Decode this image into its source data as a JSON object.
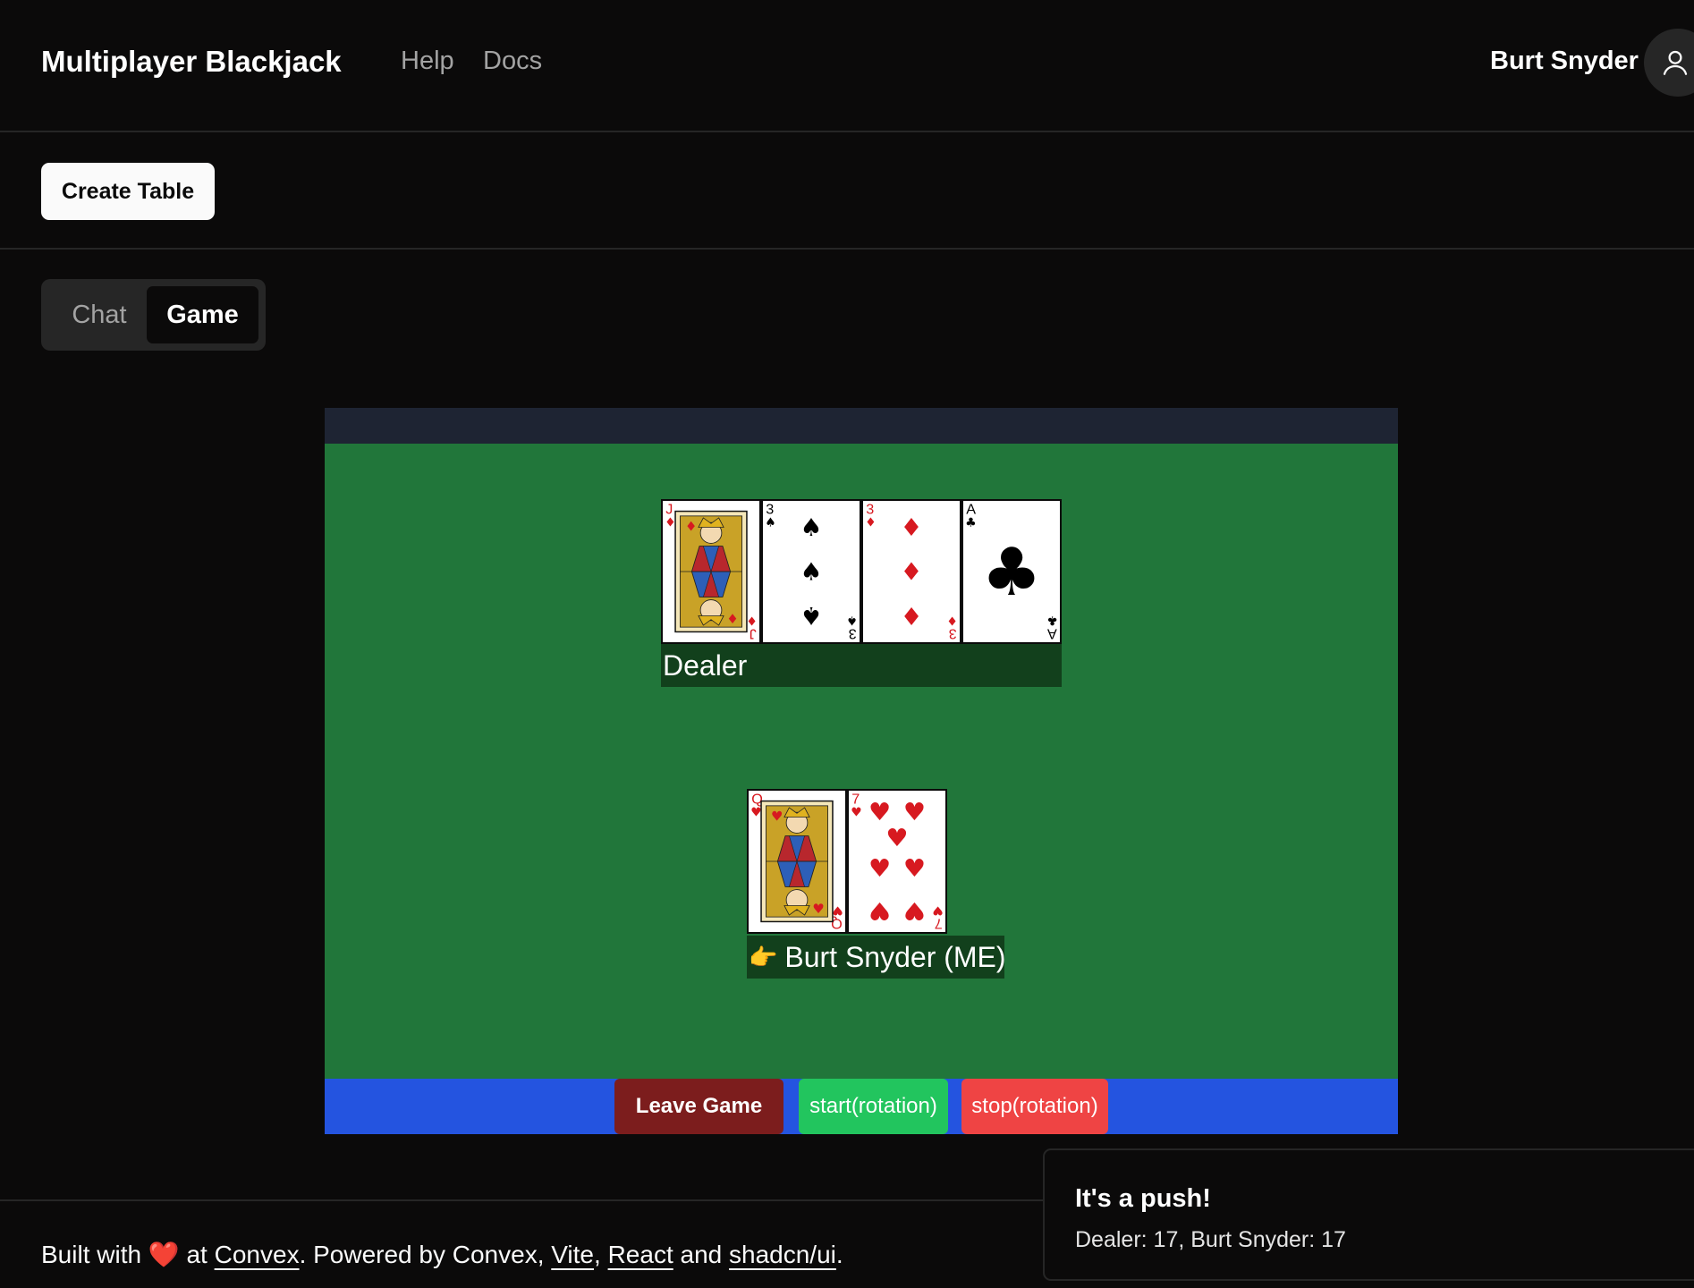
{
  "header": {
    "app_title": "Multiplayer Blackjack",
    "nav": {
      "help": "Help",
      "docs": "Docs"
    },
    "user_name": "Burt Snyder",
    "avatar_icon": "user-icon"
  },
  "toolbar": {
    "create_table_label": "Create Table"
  },
  "tabs": {
    "chat": "Chat",
    "game": "Game",
    "active": "Game"
  },
  "game": {
    "dealer": {
      "label": "Dealer",
      "cards": [
        {
          "rank": "J",
          "suit": "diamonds",
          "symbol": "♦",
          "color": "#d71920"
        },
        {
          "rank": "3",
          "suit": "spades",
          "symbol": "♠",
          "color": "#000000"
        },
        {
          "rank": "3",
          "suit": "diamonds",
          "symbol": "♦",
          "color": "#d71920"
        },
        {
          "rank": "A",
          "suit": "clubs",
          "symbol": "♣",
          "color": "#000000"
        }
      ]
    },
    "player": {
      "pointer": "👉",
      "label": "Burt Snyder (ME)",
      "cards": [
        {
          "rank": "Q",
          "suit": "hearts",
          "symbol": "♥",
          "color": "#d71920"
        },
        {
          "rank": "7",
          "suit": "hearts",
          "symbol": "♥",
          "color": "#d71920"
        }
      ]
    },
    "controls": {
      "leave": "Leave Game",
      "start": "start(rotation)",
      "stop": "stop(rotation)"
    }
  },
  "footer": {
    "built_with": "Built with",
    "heart": "❤️",
    "at": "at",
    "convex_link": "Convex",
    "powered_by": ". Powered by Convex,",
    "vite_link": "Vite",
    "comma": ",",
    "react_link": "React",
    "and": "and",
    "shadcn_link": "shadcn/ui",
    "period": "."
  },
  "toast": {
    "title": "It's a push!",
    "description": "Dealer: 17, Burt Snyder: 17"
  },
  "colors": {
    "felt": "#21763a",
    "controls_bar": "#2454e0",
    "leave_button": "#7c1d1d",
    "start_button": "#22c55e",
    "stop_button": "#ef4444"
  }
}
